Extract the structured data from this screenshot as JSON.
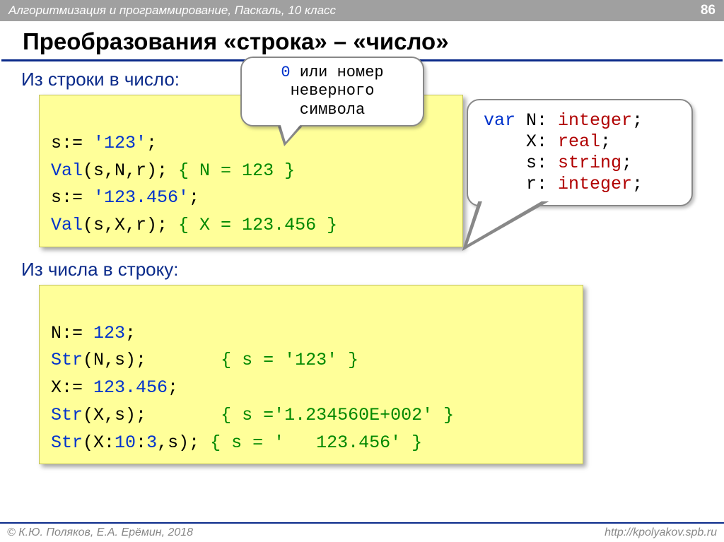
{
  "topbar": {
    "breadcrumb": "Алгоритмизация и программирование, Паскаль, 10 класс",
    "page": "86"
  },
  "title": "Преобразования «строка» – «число»",
  "sec1": "Из строки в число:",
  "bubble1_a": "0",
  "bubble1_b": " или номер неверного символа",
  "bubble2": {
    "l1a": "var",
    "l1b": " N: ",
    "l1c": "integer",
    "l1d": ";",
    "l2a": "    X: ",
    "l2b": "real",
    "l2c": ";",
    "l3a": "    s: ",
    "l3b": "string",
    "l3c": ";",
    "l4a": "    r: ",
    "l4b": "integer",
    "l4c": ";"
  },
  "box1": {
    "l1a": "s:= ",
    "l1b": "'123'",
    "l1c": ";",
    "l2a": "Val",
    "l2b": "(s,N,r); ",
    "l2c": "{ N = 123 }",
    "l3a": "s:= ",
    "l3b": "'123.456'",
    "l3c": ";",
    "l4a": "Val",
    "l4b": "(s,X,r); ",
    "l4c": "{ X = 123.456 }"
  },
  "sec2": "Из числа в строку:",
  "box2": {
    "l1a": "N:= ",
    "l1b": "123",
    "l1c": ";",
    "l2a": "Str",
    "l2b": "(N,s);       ",
    "l2c": "{ s = '123' }",
    "l3a": "X:= ",
    "l3b": "123.456",
    "l3c": ";",
    "l4a": "Str",
    "l4b": "(X,s);       ",
    "l4c": "{ s ='1.234560E+002' }",
    "l5a": "Str",
    "l5b": "(X:",
    "l5c": "10",
    "l5d": ":",
    "l5e": "3",
    "l5f": ",s); ",
    "l5g": "{ s = '   123.456' }"
  },
  "footer": {
    "left": "© К.Ю. Поляков, Е.А. Ерёмин, 2018",
    "right": "http://kpolyakov.spb.ru"
  }
}
